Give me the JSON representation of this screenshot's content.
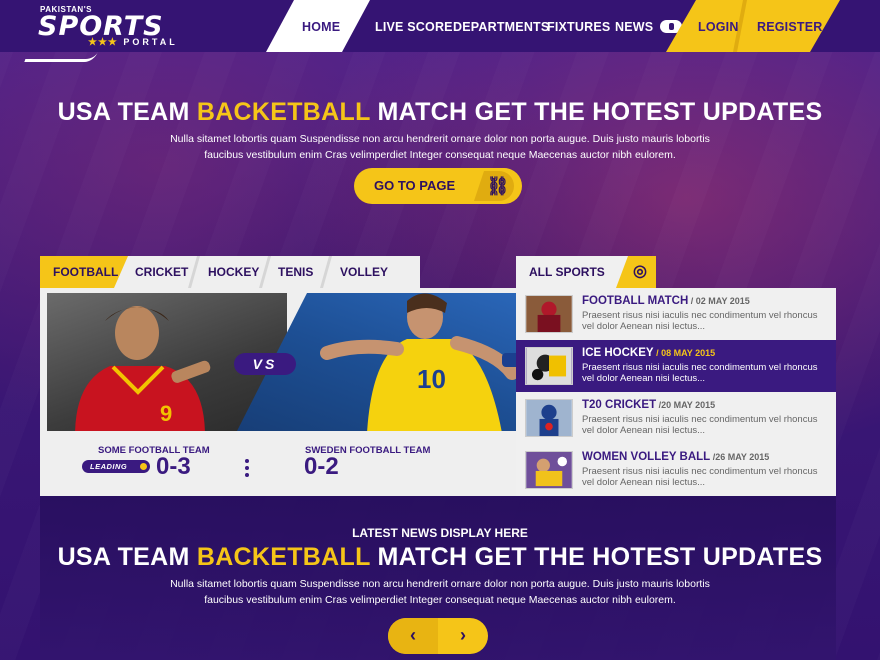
{
  "brand": {
    "top": "PAKISTAN'S",
    "main": "SPORTS",
    "sub": "PORTAL",
    "stars": "★★★"
  },
  "nav": {
    "home": "HOME",
    "live_score": "LIVE SCORE",
    "departments": "DEPARTMENTS",
    "fixtures": "FIXTURES",
    "news": "NEWS",
    "login": "LOGIN",
    "register": "REGISTER"
  },
  "hero": {
    "title_pre": "USA TEAM ",
    "title_hl": "BACKETBALL",
    "title_post": " MATCH GET THE HOTEST UPDATES",
    "line1": "Nulla sitamet lobortis quam Suspendisse non arcu hendrerit ornare dolor non porta augue. Duis justo mauris lobortis",
    "line2": "faucibus vestibulum enim Cras velimperdiet Integer consequat neque Maecenas auctor nibh eulorem.",
    "button": "GO TO PAGE"
  },
  "tabs": [
    "FOOTBALL",
    "CRICKET",
    "HOCKEY",
    "TENIS",
    "VOLLEY BALL"
  ],
  "match": {
    "vs": "VS",
    "team1": "SOME FOOTBALL TEAM",
    "team2": "SWEDEN FOOTBALL TEAM",
    "score1": "0-3",
    "score2": "0-2",
    "badge": "LEADING"
  },
  "sidebar": {
    "title": "ALL SPORTS",
    "items": [
      {
        "title": "FOOTBALL MATCH",
        "date": " / 02 MAY 2015",
        "desc": "Praesent risus nisi iaculis nec condimentum vel rhoncus vel dolor Aenean nisi lectus..."
      },
      {
        "title": "ICE HOCKEY",
        "date": " / 08 MAY 2015",
        "desc": "Praesent risus nisi iaculis nec condimentum vel rhoncus vel dolor Aenean nisi lectus..."
      },
      {
        "title": "T20 CRICKET",
        "date": " /20 MAY 2015",
        "desc": "Praesent risus nisi iaculis nec condimentum vel rhoncus vel dolor Aenean nisi lectus..."
      },
      {
        "title": "WOMEN VOLLEY BALL",
        "date": " /26 MAY 2015",
        "desc": "Praesent risus nisi iaculis nec condimentum vel rhoncus vel dolor Aenean nisi lectus..."
      }
    ]
  },
  "news": {
    "label": "LATEST NEWS DISPLAY HERE",
    "title_pre": "USA TEAM ",
    "title_hl": "BACKETBALL",
    "title_post": " MATCH GET THE HOTEST UPDATES",
    "line1": "Nulla sitamet lobortis quam Suspendisse non arcu hendrerit ornare dolor non porta augue. Duis justo mauris lobortis",
    "line2": "faucibus vestibulum enim Cras velimperdiet Integer consequat neque Maecenas auctor nibh eulorem.",
    "prev": "‹",
    "next": "›"
  },
  "colors": {
    "purple": "#3a1a80",
    "yellow": "#f5c518"
  }
}
